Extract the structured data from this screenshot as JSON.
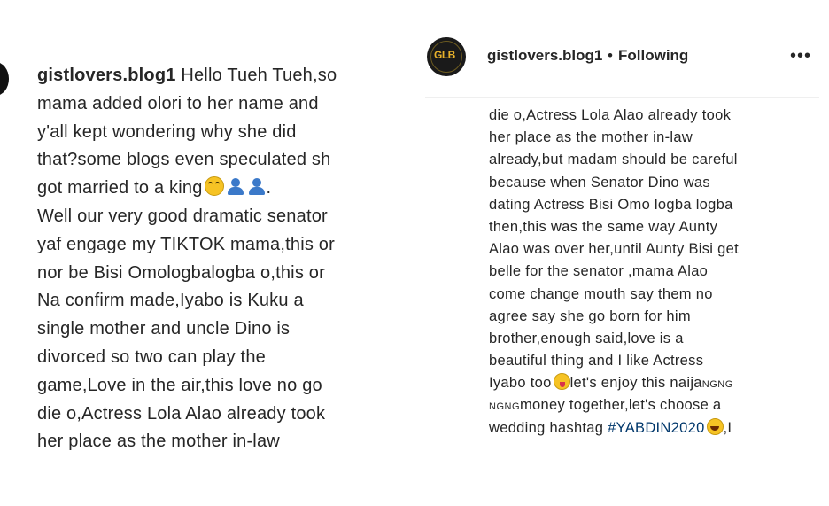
{
  "left_post": {
    "username": "gistlovers.blog1",
    "lines": [
      "Hello Tueh Tueh,so",
      "mama added olori to her name and",
      "y'all kept wondering why she did",
      "that?some blogs even speculated sh",
      "got married to a king",
      ".",
      "Well our very good dramatic senator",
      "yaf engage my TIKTOK mama,this or",
      "nor be Bisi Omologbalogba o,this or",
      "Na confirm made,Iyabo is Kuku a",
      "single mother and uncle Dino is",
      "divorced so two can play the",
      "game,Love in the air,this love no go",
      "die o,Actress Lola Alao already took",
      "her place as the mother in-law"
    ],
    "emojis": [
      "rofl-emoji",
      "user-emoji",
      "user-emoji"
    ]
  },
  "right_post": {
    "username": "gistlovers.blog1",
    "separator": "•",
    "follow_status": "Following",
    "more_label": "•••",
    "avatar_text": "GLB",
    "lines": [
      "die o,Actress Lola Alao already took",
      "her place as the mother in-law",
      "already,but madam should be careful",
      "because when Senator Dino was",
      "dating Actress Bisi Omo logba logba",
      "then,this was the same way Aunty",
      "Alao was over her,until Aunty Bisi get",
      "belle for the senator ,mama Alao",
      "come change mouth say them no",
      "agree say she go born for him",
      "brother,enough said,love is a",
      "beautiful thing and I like Actress",
      "Iyabo too",
      "let's enjoy this naija",
      "NGNG",
      "NGNG",
      "money together,let's choose a",
      "wedding hashtag ",
      "#YABDIN2020",
      ",I"
    ],
    "emojis": [
      "tongue-emoji",
      "laugh-emoji"
    ]
  }
}
